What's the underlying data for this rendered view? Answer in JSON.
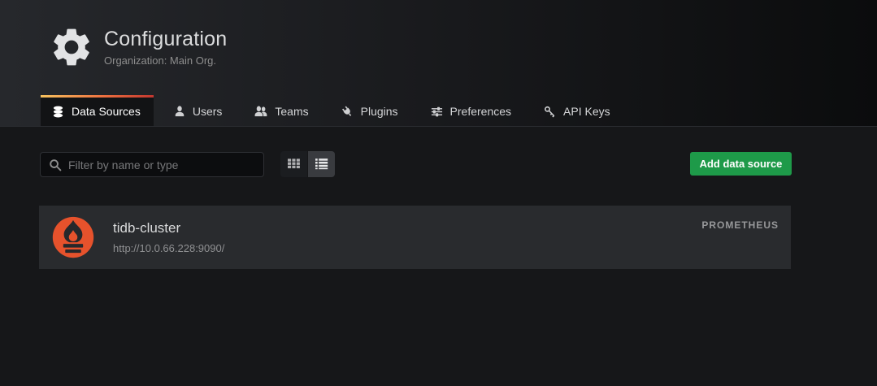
{
  "header": {
    "title": "Configuration",
    "subtitle": "Organization: Main Org.",
    "icon": "gear-icon"
  },
  "tabs": [
    {
      "label": "Data Sources",
      "icon": "database-icon",
      "active": true
    },
    {
      "label": "Users",
      "icon": "user-icon",
      "active": false
    },
    {
      "label": "Teams",
      "icon": "users-icon",
      "active": false
    },
    {
      "label": "Plugins",
      "icon": "plug-icon",
      "active": false
    },
    {
      "label": "Preferences",
      "icon": "sliders-icon",
      "active": false
    },
    {
      "label": "API Keys",
      "icon": "key-icon",
      "active": false
    }
  ],
  "toolbar": {
    "filter_placeholder": "Filter by name or type",
    "view_modes": [
      {
        "name": "grid",
        "active": false
      },
      {
        "name": "list",
        "active": true
      }
    ],
    "add_button_label": "Add data source"
  },
  "datasources": [
    {
      "name": "tidb-cluster",
      "url": "http://10.0.66.228:9090/",
      "type_label": "PROMETHEUS",
      "icon": "prometheus-icon"
    }
  ],
  "colors": {
    "page_bg": "#161719",
    "header_bg_left": "#26282c",
    "header_bg_right": "#0b0c0d",
    "row_bg": "#292b2e",
    "accent_green": "#1e9a49",
    "prometheus_orange": "#e6522c",
    "active_tab_gradient_start": "#f6c35f",
    "active_tab_gradient_end": "#c2362f",
    "text_primary": "#d8d9da",
    "text_muted": "#8e8e8e"
  }
}
